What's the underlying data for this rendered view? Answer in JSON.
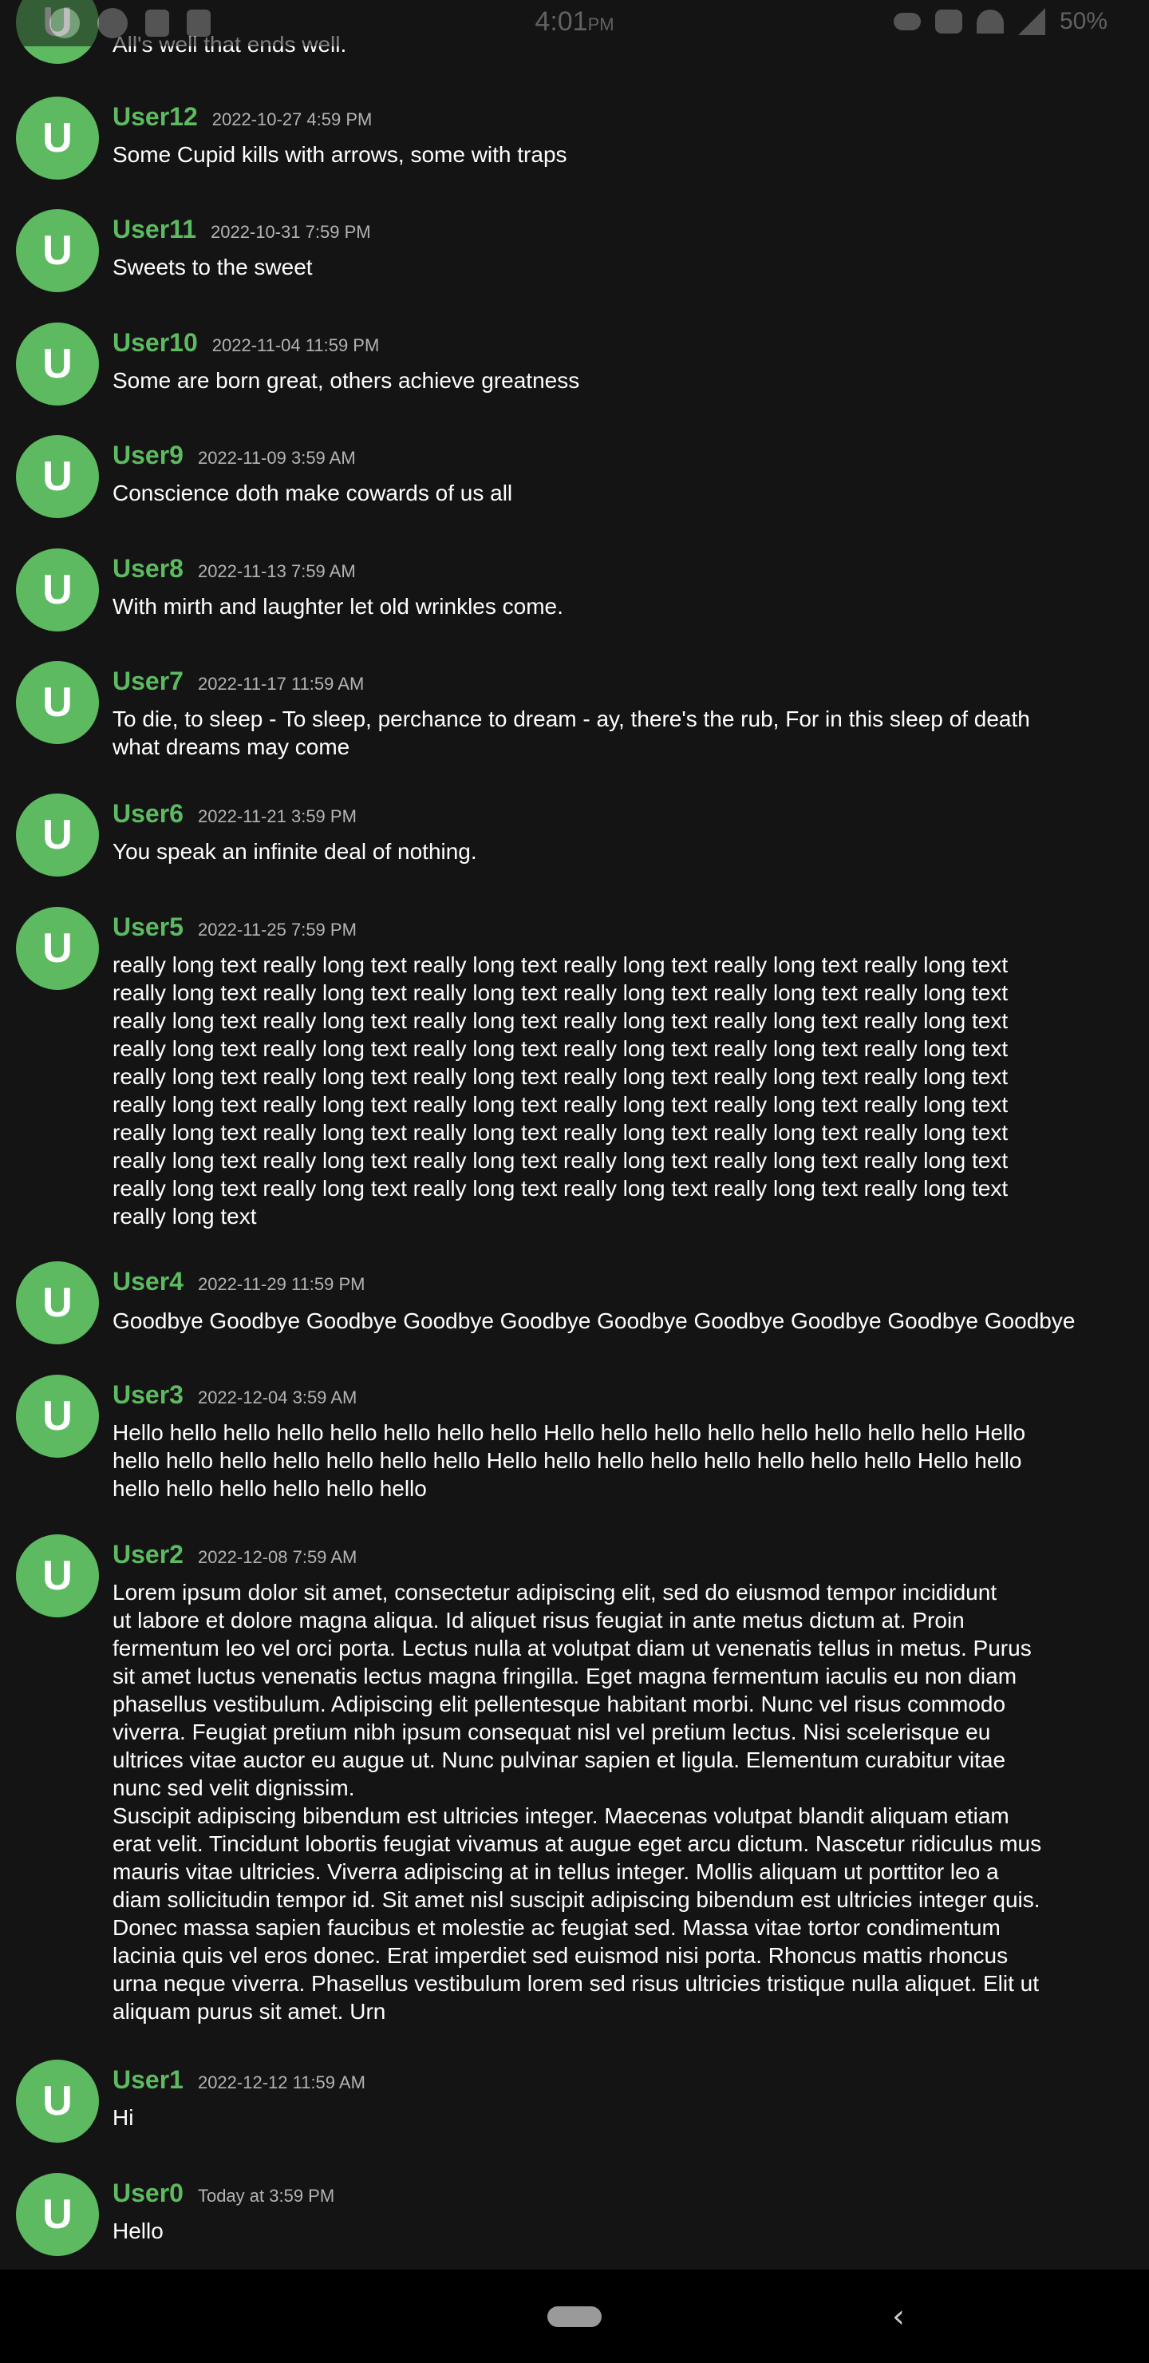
{
  "status_bar": {
    "time": "4:01",
    "time_suffix": "PM",
    "battery": "50%"
  },
  "messages": [
    {
      "avatar": "U",
      "user": "",
      "time": "",
      "text": "All's well that ends well."
    },
    {
      "avatar": "U",
      "user": "User12",
      "time": "2022-10-27 4:59 PM",
      "text": "Some Cupid kills with arrows, some with traps"
    },
    {
      "avatar": "U",
      "user": "User11",
      "time": "2022-10-31 7:59 PM",
      "text": "Sweets to the sweet"
    },
    {
      "avatar": "U",
      "user": "User10",
      "time": "2022-11-04 11:59 PM",
      "text": "Some are born great, others achieve greatness"
    },
    {
      "avatar": "U",
      "user": "User9",
      "time": "2022-11-09 3:59 AM",
      "text": "Conscience doth make cowards of us all"
    },
    {
      "avatar": "U",
      "user": "User8",
      "time": "2022-11-13 7:59 AM",
      "text": "With mirth and laughter let old wrinkles come."
    },
    {
      "avatar": "U",
      "user": "User7",
      "time": "2022-11-17 11:59 AM",
      "text": "To die, to sleep - To sleep, perchance to dream - ay, there's the rub, For in this sleep of death\nwhat dreams may come"
    },
    {
      "avatar": "U",
      "user": "User6",
      "time": "2022-11-21 3:59 PM",
      "text": "You speak an infinite deal of nothing."
    },
    {
      "avatar": "U",
      "user": "User5",
      "time": "2022-11-25 7:59 PM",
      "text": "really long text really long text really long text really long text really long text really long text\nreally long text really long text really long text really long text really long text really long text\nreally long text really long text really long text really long text really long text really long text\nreally long text really long text really long text really long text really long text really long text\nreally long text really long text really long text really long text really long text really long text\nreally long text really long text really long text really long text really long text really long text\nreally long text really long text really long text really long text really long text really long text\nreally long text really long text really long text really long text really long text really long text\nreally long text really long text really long text really long text really long text really long text\nreally long text"
    },
    {
      "avatar": "U",
      "user": "User4",
      "time": "2022-11-29 11:59 PM",
      "text": "Goodbye Goodbye Goodbye Goodbye Goodbye Goodbye Goodbye Goodbye Goodbye Goodbye"
    },
    {
      "avatar": "U",
      "user": "User3",
      "time": "2022-12-04 3:59 AM",
      "text": "Hello hello hello hello hello hello hello hello Hello hello hello hello hello hello hello hello Hello\nhello hello hello hello hello hello hello Hello hello hello hello hello hello hello hello Hello hello\nhello hello hello hello hello hello"
    },
    {
      "avatar": "U",
      "user": "User2",
      "time": "2022-12-08 7:59 AM",
      "text": "Lorem ipsum dolor sit amet, consectetur adipiscing elit, sed do eiusmod tempor incididunt\nut labore et dolore magna aliqua. Id aliquet risus feugiat in ante metus dictum at. Proin\nfermentum leo vel orci porta. Lectus nulla at volutpat diam ut venenatis tellus in metus. Purus\nsit amet luctus venenatis lectus magna fringilla. Eget magna fermentum iaculis eu non diam\nphasellus vestibulum. Adipiscing elit pellentesque habitant morbi. Nunc vel risus commodo\nviverra. Feugiat pretium nibh ipsum consequat nisl vel pretium lectus. Nisi scelerisque eu\nultrices vitae auctor eu augue ut. Nunc pulvinar sapien et ligula. Elementum curabitur vitae\nnunc sed velit dignissim.\nSuscipit adipiscing bibendum est ultricies integer. Maecenas volutpat blandit aliquam etiam\nerat velit. Tincidunt lobortis feugiat vivamus at augue eget arcu dictum. Nascetur ridiculus mus\nmauris vitae ultricies. Viverra adipiscing at in tellus integer. Mollis aliquam ut porttitor leo a\ndiam sollicitudin tempor id. Sit amet nisl suscipit adipiscing bibendum est ultricies integer quis.\nDonec massa sapien faucibus et molestie ac feugiat sed. Massa vitae tortor condimentum\nlacinia quis vel eros donec. Erat imperdiet sed euismod nisi porta. Rhoncus mattis rhoncus\nurna neque viverra. Phasellus vestibulum lorem sed risus ultricies tristique nulla aliquet. Elit ut\naliquam purus sit amet. Urn"
    },
    {
      "avatar": "U",
      "user": "User1",
      "time": "2022-12-12 11:59 AM",
      "text": "Hi"
    },
    {
      "avatar": "U",
      "user": "User0",
      "time": "Today at 3:59 PM",
      "text": "Hello"
    }
  ],
  "nav": {
    "back_glyph": "‹"
  }
}
